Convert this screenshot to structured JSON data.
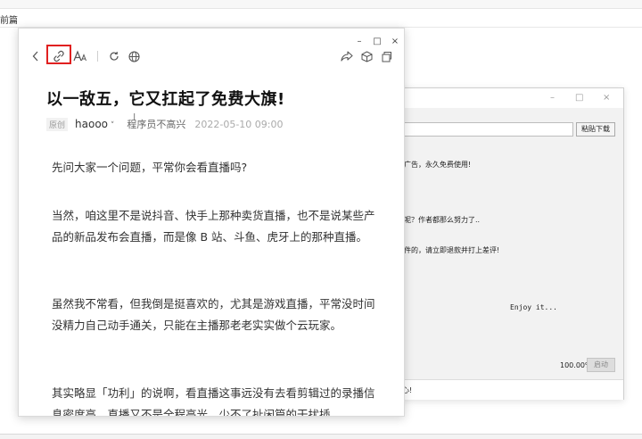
{
  "background": {
    "bar_text": "前篇"
  },
  "dialog": {
    "download_button": "粘贴下载",
    "lines": [
      "广告，永久免费使用!",
      "呢？作者都那么努力了..",
      "件的，请立即退款并打上差评!",
      "Enjoy it..."
    ],
    "percent": "100.00%",
    "start_button": "启动",
    "footer": "心!"
  },
  "window": {
    "controls": {
      "minimize": "–",
      "maximize": "□",
      "close": "×"
    }
  },
  "article": {
    "title": "以一敌五，它又扛起了免费大旗!",
    "badge": "原创",
    "author": "haooo",
    "account": "程序员不高兴",
    "date": "2022-05-10 09:00",
    "paragraphs": [
      "先问大家一个问题，平常你会看直播吗?",
      "当然，咱这里不是说抖音、快手上那种卖货直播，也不是说某些产品的新品发布会直播，而是像 B 站、斗鱼、虎牙上的那种直播。",
      "虽然我不常看，但我倒是挺喜欢的，尤其是游戏直播，平常没时间没精力自己动手通关，只能在主播那老老实实做个云玩家。",
      "其实略显「功利」的说啊，看直播这事远没有去看剪辑过的录播信息密度高，直播又不是全程高光，少不了扯闲篇的干扰插"
    ]
  },
  "icons": {
    "back": "chevron-left-icon",
    "link": "link-icon",
    "font": "font-size-icon",
    "refresh": "refresh-icon",
    "globe": "globe-icon",
    "share": "share-icon",
    "cube": "cube-icon",
    "window": "window-icon"
  },
  "colors": {
    "highlight": "#e02020"
  }
}
